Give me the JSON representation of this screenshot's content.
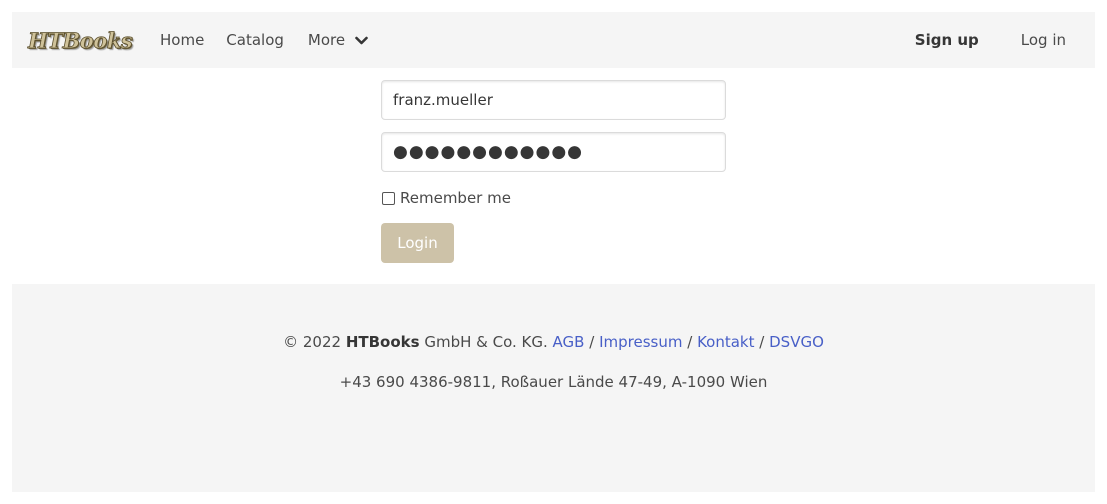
{
  "navbar": {
    "logo_text": "HTBooks",
    "home": "Home",
    "catalog": "Catalog",
    "more": "More",
    "signup": "Sign up",
    "login": "Log in"
  },
  "login_form": {
    "username_value": "franz.mueller",
    "password_value": "●●●●●●●●●●●●",
    "remember_label": "Remember me",
    "remember_checked": false,
    "submit_label": "Login"
  },
  "footer": {
    "copyright_prefix": "© 2022 ",
    "brand": "HTBooks",
    "company_suffix": " GmbH & Co. KG. ",
    "links": {
      "agb": "AGB",
      "impressum": "Impressum",
      "kontakt": "Kontakt",
      "dsvgo": "DSVGO"
    },
    "separator": "/",
    "contact_line": "+43 690 4386-9811, Roßauer Lände 47-49, A-1090 Wien"
  },
  "colors": {
    "navbar_bg": "#f5f5f5",
    "link": "#485fc7",
    "login_button": "#cdc2a8",
    "text": "#4a4a4a"
  },
  "icons": {
    "more_dropdown": "chevron-down-icon",
    "logo": "htbooks-logo"
  }
}
